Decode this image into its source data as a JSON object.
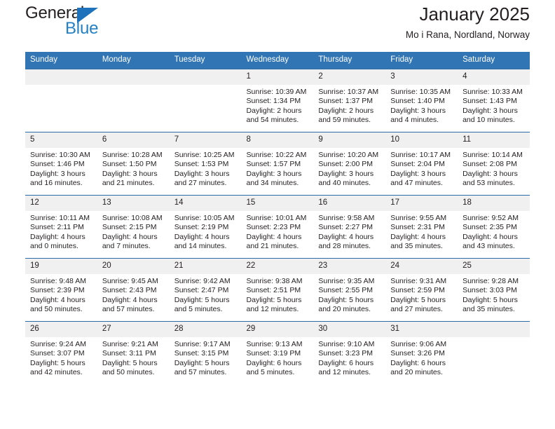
{
  "brand": {
    "word_one": "General",
    "word_two": "Blue",
    "triangle_color": "#1d72bb",
    "blue_color": "#2581c4"
  },
  "header": {
    "title": "January 2025",
    "subtitle": "Mo i Rana, Nordland, Norway"
  },
  "calendar": {
    "header_bg": "#3175b4",
    "row_border_color": "#2b6ca8",
    "daynum_bg": "#f0f0f0",
    "weekdays": [
      "Sunday",
      "Monday",
      "Tuesday",
      "Wednesday",
      "Thursday",
      "Friday",
      "Saturday"
    ],
    "weeks": [
      [
        {
          "day": ""
        },
        {
          "day": ""
        },
        {
          "day": ""
        },
        {
          "day": "1",
          "sunrise": "Sunrise: 10:39 AM",
          "sunset": "Sunset: 1:34 PM",
          "daylight_line1": "Daylight: 2 hours",
          "daylight_line2": "and 54 minutes."
        },
        {
          "day": "2",
          "sunrise": "Sunrise: 10:37 AM",
          "sunset": "Sunset: 1:37 PM",
          "daylight_line1": "Daylight: 2 hours",
          "daylight_line2": "and 59 minutes."
        },
        {
          "day": "3",
          "sunrise": "Sunrise: 10:35 AM",
          "sunset": "Sunset: 1:40 PM",
          "daylight_line1": "Daylight: 3 hours",
          "daylight_line2": "and 4 minutes."
        },
        {
          "day": "4",
          "sunrise": "Sunrise: 10:33 AM",
          "sunset": "Sunset: 1:43 PM",
          "daylight_line1": "Daylight: 3 hours",
          "daylight_line2": "and 10 minutes."
        }
      ],
      [
        {
          "day": "5",
          "sunrise": "Sunrise: 10:30 AM",
          "sunset": "Sunset: 1:46 PM",
          "daylight_line1": "Daylight: 3 hours",
          "daylight_line2": "and 16 minutes."
        },
        {
          "day": "6",
          "sunrise": "Sunrise: 10:28 AM",
          "sunset": "Sunset: 1:50 PM",
          "daylight_line1": "Daylight: 3 hours",
          "daylight_line2": "and 21 minutes."
        },
        {
          "day": "7",
          "sunrise": "Sunrise: 10:25 AM",
          "sunset": "Sunset: 1:53 PM",
          "daylight_line1": "Daylight: 3 hours",
          "daylight_line2": "and 27 minutes."
        },
        {
          "day": "8",
          "sunrise": "Sunrise: 10:22 AM",
          "sunset": "Sunset: 1:57 PM",
          "daylight_line1": "Daylight: 3 hours",
          "daylight_line2": "and 34 minutes."
        },
        {
          "day": "9",
          "sunrise": "Sunrise: 10:20 AM",
          "sunset": "Sunset: 2:00 PM",
          "daylight_line1": "Daylight: 3 hours",
          "daylight_line2": "and 40 minutes."
        },
        {
          "day": "10",
          "sunrise": "Sunrise: 10:17 AM",
          "sunset": "Sunset: 2:04 PM",
          "daylight_line1": "Daylight: 3 hours",
          "daylight_line2": "and 47 minutes."
        },
        {
          "day": "11",
          "sunrise": "Sunrise: 10:14 AM",
          "sunset": "Sunset: 2:08 PM",
          "daylight_line1": "Daylight: 3 hours",
          "daylight_line2": "and 53 minutes."
        }
      ],
      [
        {
          "day": "12",
          "sunrise": "Sunrise: 10:11 AM",
          "sunset": "Sunset: 2:11 PM",
          "daylight_line1": "Daylight: 4 hours",
          "daylight_line2": "and 0 minutes."
        },
        {
          "day": "13",
          "sunrise": "Sunrise: 10:08 AM",
          "sunset": "Sunset: 2:15 PM",
          "daylight_line1": "Daylight: 4 hours",
          "daylight_line2": "and 7 minutes."
        },
        {
          "day": "14",
          "sunrise": "Sunrise: 10:05 AM",
          "sunset": "Sunset: 2:19 PM",
          "daylight_line1": "Daylight: 4 hours",
          "daylight_line2": "and 14 minutes."
        },
        {
          "day": "15",
          "sunrise": "Sunrise: 10:01 AM",
          "sunset": "Sunset: 2:23 PM",
          "daylight_line1": "Daylight: 4 hours",
          "daylight_line2": "and 21 minutes."
        },
        {
          "day": "16",
          "sunrise": "Sunrise: 9:58 AM",
          "sunset": "Sunset: 2:27 PM",
          "daylight_line1": "Daylight: 4 hours",
          "daylight_line2": "and 28 minutes."
        },
        {
          "day": "17",
          "sunrise": "Sunrise: 9:55 AM",
          "sunset": "Sunset: 2:31 PM",
          "daylight_line1": "Daylight: 4 hours",
          "daylight_line2": "and 35 minutes."
        },
        {
          "day": "18",
          "sunrise": "Sunrise: 9:52 AM",
          "sunset": "Sunset: 2:35 PM",
          "daylight_line1": "Daylight: 4 hours",
          "daylight_line2": "and 43 minutes."
        }
      ],
      [
        {
          "day": "19",
          "sunrise": "Sunrise: 9:48 AM",
          "sunset": "Sunset: 2:39 PM",
          "daylight_line1": "Daylight: 4 hours",
          "daylight_line2": "and 50 minutes."
        },
        {
          "day": "20",
          "sunrise": "Sunrise: 9:45 AM",
          "sunset": "Sunset: 2:43 PM",
          "daylight_line1": "Daylight: 4 hours",
          "daylight_line2": "and 57 minutes."
        },
        {
          "day": "21",
          "sunrise": "Sunrise: 9:42 AM",
          "sunset": "Sunset: 2:47 PM",
          "daylight_line1": "Daylight: 5 hours",
          "daylight_line2": "and 5 minutes."
        },
        {
          "day": "22",
          "sunrise": "Sunrise: 9:38 AM",
          "sunset": "Sunset: 2:51 PM",
          "daylight_line1": "Daylight: 5 hours",
          "daylight_line2": "and 12 minutes."
        },
        {
          "day": "23",
          "sunrise": "Sunrise: 9:35 AM",
          "sunset": "Sunset: 2:55 PM",
          "daylight_line1": "Daylight: 5 hours",
          "daylight_line2": "and 20 minutes."
        },
        {
          "day": "24",
          "sunrise": "Sunrise: 9:31 AM",
          "sunset": "Sunset: 2:59 PM",
          "daylight_line1": "Daylight: 5 hours",
          "daylight_line2": "and 27 minutes."
        },
        {
          "day": "25",
          "sunrise": "Sunrise: 9:28 AM",
          "sunset": "Sunset: 3:03 PM",
          "daylight_line1": "Daylight: 5 hours",
          "daylight_line2": "and 35 minutes."
        }
      ],
      [
        {
          "day": "26",
          "sunrise": "Sunrise: 9:24 AM",
          "sunset": "Sunset: 3:07 PM",
          "daylight_line1": "Daylight: 5 hours",
          "daylight_line2": "and 42 minutes."
        },
        {
          "day": "27",
          "sunrise": "Sunrise: 9:21 AM",
          "sunset": "Sunset: 3:11 PM",
          "daylight_line1": "Daylight: 5 hours",
          "daylight_line2": "and 50 minutes."
        },
        {
          "day": "28",
          "sunrise": "Sunrise: 9:17 AM",
          "sunset": "Sunset: 3:15 PM",
          "daylight_line1": "Daylight: 5 hours",
          "daylight_line2": "and 57 minutes."
        },
        {
          "day": "29",
          "sunrise": "Sunrise: 9:13 AM",
          "sunset": "Sunset: 3:19 PM",
          "daylight_line1": "Daylight: 6 hours",
          "daylight_line2": "and 5 minutes."
        },
        {
          "day": "30",
          "sunrise": "Sunrise: 9:10 AM",
          "sunset": "Sunset: 3:23 PM",
          "daylight_line1": "Daylight: 6 hours",
          "daylight_line2": "and 12 minutes."
        },
        {
          "day": "31",
          "sunrise": "Sunrise: 9:06 AM",
          "sunset": "Sunset: 3:26 PM",
          "daylight_line1": "Daylight: 6 hours",
          "daylight_line2": "and 20 minutes."
        },
        {
          "day": ""
        }
      ]
    ]
  }
}
